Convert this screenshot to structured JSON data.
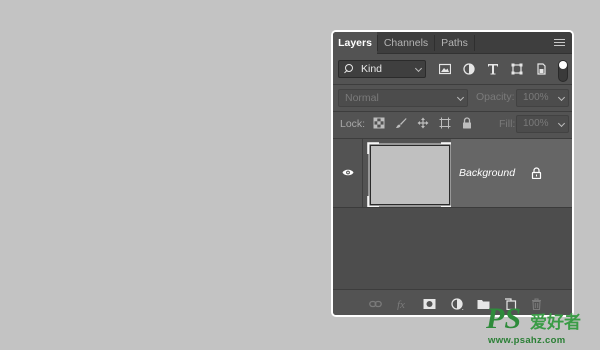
{
  "tabs": [
    "Layers",
    "Channels",
    "Paths"
  ],
  "filter": {
    "kind_label": "Kind"
  },
  "blend": {
    "mode": "Normal",
    "opacity_label": "Opacity:",
    "opacity_value": "100%"
  },
  "lock": {
    "label": "Lock:",
    "fill_label": "Fill:",
    "fill_value": "100%"
  },
  "layers": [
    {
      "name": "Background",
      "visible": true,
      "locked": true
    }
  ],
  "colors": {
    "panel": "#535353",
    "tabbar": "#3e3e3e",
    "selected_row": "#666666",
    "canvas": "#c3c3c3",
    "thumbnail": "#c0c0c0"
  },
  "watermark": {
    "brand": "PS",
    "chinese": "爱好者",
    "url": "www.psahz.com"
  }
}
